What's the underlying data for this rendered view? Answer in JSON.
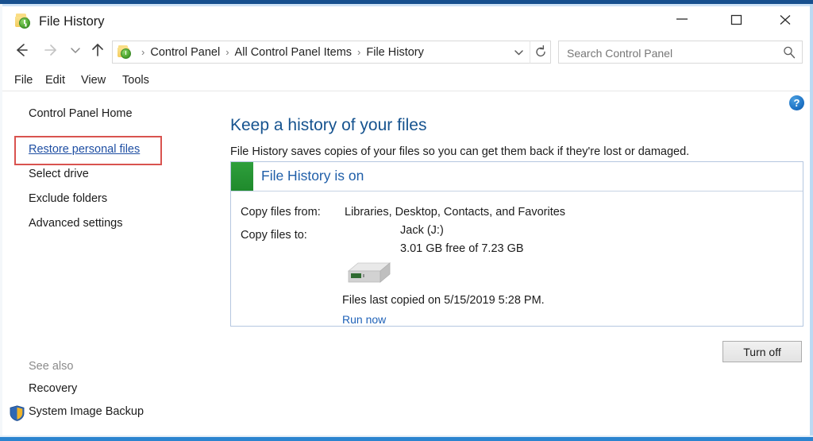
{
  "window": {
    "title": "File History",
    "icon": "file-history-folder-icon",
    "controls": {
      "minimize": "minimize-icon",
      "maximize": "maximize-icon",
      "close": "close-icon"
    }
  },
  "addressbar": {
    "back": "back-arrow-icon",
    "forward": "forward-arrow-icon",
    "recent": "recent-locations-chevron-icon",
    "up": "up-arrow-icon",
    "crumb_icon": "file-history-folder-icon",
    "breadcrumbs": [
      "Control Panel",
      "All Control Panel Items",
      "File History"
    ],
    "separator": "›",
    "dropdown": "chevron-down-icon",
    "refresh": "refresh-icon",
    "search": {
      "placeholder": "Search Control Panel",
      "value": "",
      "icon": "search-icon"
    }
  },
  "menubar": {
    "items": [
      "File",
      "Edit",
      "View",
      "Tools"
    ]
  },
  "sidebar": {
    "items": [
      {
        "label": "Control Panel Home",
        "style": "plain"
      },
      {
        "label": "Restore personal files",
        "style": "link",
        "highlighted": true
      },
      {
        "label": "Select drive",
        "style": "plain"
      },
      {
        "label": "Exclude folders",
        "style": "plain"
      },
      {
        "label": "Advanced settings",
        "style": "plain"
      }
    ],
    "highlight_color": "#d9534f",
    "see_also_label": "See also",
    "see_also_items": [
      {
        "label": "Recovery",
        "icon": null
      },
      {
        "label": "System Image Backup",
        "icon": "uac-shield-icon"
      }
    ]
  },
  "main": {
    "help_icon_label": "?",
    "heading": "Keep a history of your files",
    "subheading": "File History saves copies of your files so you can get them back if they're lost or damaged.",
    "status": {
      "title": "File History is on",
      "swatch_color": "#2e9f3c"
    },
    "rows": [
      {
        "label": "Copy files from:",
        "value": "Libraries, Desktop, Contacts, and Favorites"
      },
      {
        "label": "Copy files to:",
        "value": ""
      }
    ],
    "drive": {
      "icon": "external-hard-drive-icon",
      "name": "Jack (J:)",
      "capacity": "3.01 GB free of 7.23 GB"
    },
    "last_copied": "Files last copied on 5/15/2019 5:28 PM.",
    "run_now_label": "Run now",
    "turn_off_label": "Turn off"
  }
}
